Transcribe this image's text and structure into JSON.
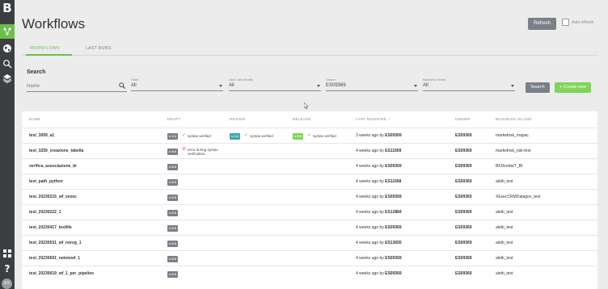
{
  "sidebar": {
    "logo": "B",
    "items": [
      {
        "name": "workflows",
        "icon": "flow-icon",
        "active": true
      },
      {
        "name": "islands",
        "icon": "globe-icon",
        "active": false
      },
      {
        "name": "search",
        "icon": "search-icon",
        "active": false
      },
      {
        "name": "layers",
        "icon": "layers-icon",
        "active": false
      }
    ],
    "bottom_items": [
      {
        "name": "apps",
        "icon": "grid-icon"
      },
      {
        "name": "help",
        "icon": "help-icon"
      }
    ],
    "avatar": "ES"
  },
  "header": {
    "title": "Workflows",
    "refresh_label": "Refresh",
    "auto_refresh_label": "Auto refresh"
  },
  "tabs": [
    {
      "label": "WORKFLOWS",
      "active": true
    },
    {
      "label": "LAST RUNS",
      "active": false
    }
  ],
  "search": {
    "title": "Search",
    "name_placeholder": "Name",
    "filters": [
      {
        "label": "State",
        "value": "All"
      },
      {
        "label": "User Last Modify",
        "value": "All"
      },
      {
        "label": "Owner",
        "value": "ES09369"
      },
      {
        "label": "Business Island",
        "value": "All"
      }
    ],
    "search_button": "Search",
    "create_button": "+ Create new"
  },
  "table": {
    "columns": [
      "NAME",
      "DRAFT",
      "REVIEW",
      "RELEASE",
      "LAST MODIFIED",
      "OWNER",
      "BUSINESS ISLAND"
    ],
    "rows": [
      {
        "name": "test_3009_a1",
        "draft_ver": "v 1.1",
        "draft_status": "syntax verified",
        "draft_ok": true,
        "review_ver": "v 1.0",
        "review_status": "syntax verified",
        "release_ver": "v 0.9",
        "release_status": "syntax verified",
        "modified": "3 weeks ago by",
        "modified_by": "ES09369",
        "owner": "ES09369",
        "island": "marketrisk_mapac"
      },
      {
        "name": "test_3259_creazione_tabella",
        "draft_ver": "v 5.0",
        "draft_status": "error during syntax verification",
        "draft_ok": false,
        "review_ver": "",
        "review_status": "",
        "release_ver": "",
        "release_status": "",
        "modified": "4 weeks ago by",
        "modified_by": "ES11569",
        "owner": "ES09369",
        "island": "marketrisk_risk-test"
      },
      {
        "name": "verifica_associazione_bi",
        "draft_ver": "v 0.0",
        "draft_status": "",
        "draft_ok": true,
        "review_ver": "",
        "review_status": "",
        "release_ver": "",
        "release_status": "",
        "modified": "4 weeks ago by",
        "modified_by": "ES09369",
        "owner": "ES09369",
        "island": "BKDirettaIT_BI"
      },
      {
        "name": "test_path_python",
        "draft_ver": "v 0.0",
        "draft_status": "",
        "draft_ok": true,
        "review_ver": "",
        "review_status": "",
        "release_ver": "",
        "release_status": "",
        "modified": "4 weeks ago by",
        "modified_by": "ES11568",
        "owner": "ES09369",
        "island": "aletti_test"
      },
      {
        "name": "test_20230215_wf_xexec",
        "draft_ver": "v 0.0",
        "draft_status": "",
        "draft_ok": true,
        "review_ver": "",
        "review_status": "",
        "release_ver": "",
        "release_status": "",
        "modified": "4 weeks ago by",
        "modified_by": "ES09369",
        "owner": "ES09369",
        "island": "XExecCRMDatagov_test"
      },
      {
        "name": "test_20230222_1",
        "draft_ver": "v 0.0",
        "draft_status": "",
        "draft_ok": true,
        "review_ver": "",
        "review_status": "",
        "release_ver": "",
        "release_status": "",
        "modified": "4 weeks ago by",
        "modified_by": "ES12884",
        "owner": "ES09369",
        "island": "aletti_test"
      },
      {
        "name": "test_20230417_textfile",
        "draft_ver": "v 0.0",
        "draft_status": "",
        "draft_ok": true,
        "review_ver": "",
        "review_status": "",
        "release_ver": "",
        "release_status": "",
        "modified": "4 weeks ago by",
        "modified_by": "ES09369",
        "owner": "ES09369",
        "island": "aletti_test"
      },
      {
        "name": "test_20230531_wf_noreg_1",
        "draft_ver": "v 0.0",
        "draft_status": "",
        "draft_ok": true,
        "review_ver": "",
        "review_status": "",
        "release_ver": "",
        "release_status": "",
        "modified": "4 weeks ago by",
        "modified_by": "ES13655",
        "owner": "ES09369",
        "island": "aletti_test"
      },
      {
        "name": "test_20230601_notetowf_1",
        "draft_ver": "v 0.0",
        "draft_status": "",
        "draft_ok": true,
        "review_ver": "",
        "review_status": "",
        "release_ver": "",
        "release_status": "",
        "modified": "4 weeks ago by",
        "modified_by": "ES09369",
        "owner": "ES09369",
        "island": "aletti_test"
      },
      {
        "name": "test_20230619_wf_1_per_pipeline",
        "draft_ver": "v 0.0",
        "draft_status": "",
        "draft_ok": true,
        "review_ver": "",
        "review_status": "",
        "release_ver": "",
        "release_status": "",
        "modified": "4 weeks ago by",
        "modified_by": "ES09369",
        "owner": "ES09369",
        "island": "aletti_test"
      }
    ]
  },
  "colors": {
    "accent": "#6bc04b",
    "sidebar": "#3c3f42",
    "button_grey": "#7a8087",
    "create_green": "#7fd55a",
    "review_teal": "#3fa7b3",
    "error": "#d9534f"
  }
}
